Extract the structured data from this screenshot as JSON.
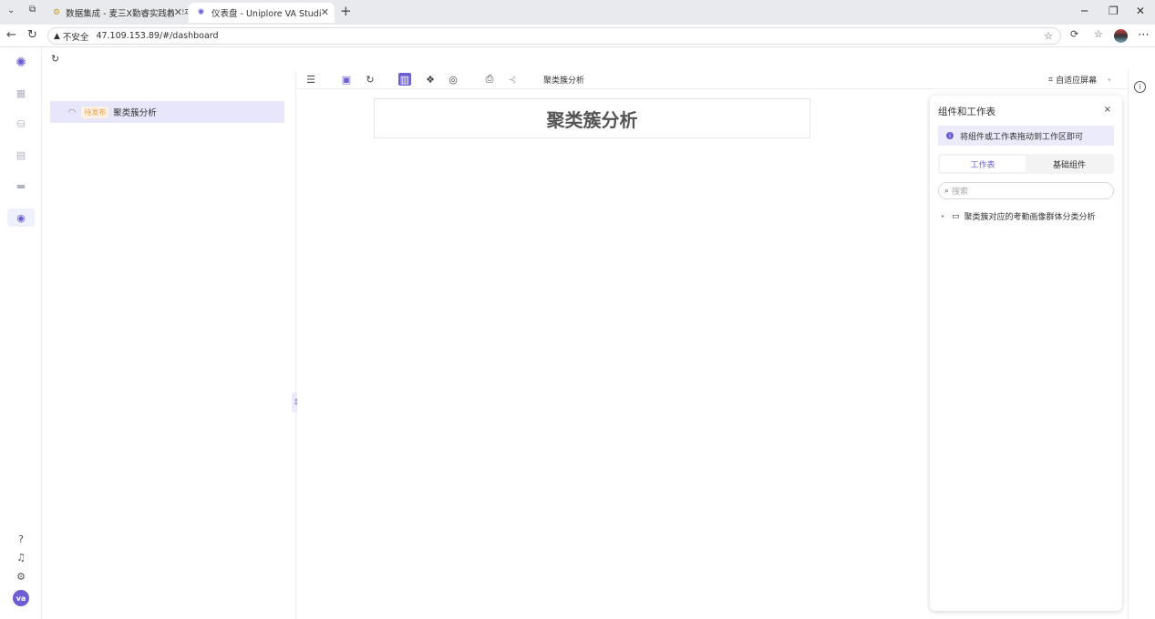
{
  "browser": {
    "tabs": [
      {
        "label": "数据集成 - 麦三X勤睿实践教学平台",
        "icon": "gear-favicon"
      },
      {
        "label": "仪表盘 - Uniplore VA Studio",
        "icon": "uniplore-favicon"
      }
    ],
    "new_tab": "+",
    "url_warning": "不安全",
    "url": "47.109.153.89/#/dashboard"
  },
  "app": {
    "toolbar": {
      "search_placeholder": "搜索",
      "dashboard_name": "聚类簇分析",
      "fit_screen_label": "自适应屏幕"
    },
    "tree": {
      "items": [
        {
          "status": "待发布",
          "label": "聚类簇分析"
        }
      ]
    },
    "canvas": {
      "title": "聚类簇分析"
    },
    "panel": {
      "title": "组件和工作表",
      "close": "×",
      "tip": "将组件或工作表拖动到工作区即可",
      "tabs": [
        "工作表",
        "基础组件"
      ],
      "active_tab": 0,
      "search_placeholder": "搜索",
      "nodes": [
        {
          "label": "聚类簇对应的考勤画像群体分类分析"
        }
      ]
    },
    "user_avatar": "va",
    "accent_color": "#6b5fd3"
  }
}
